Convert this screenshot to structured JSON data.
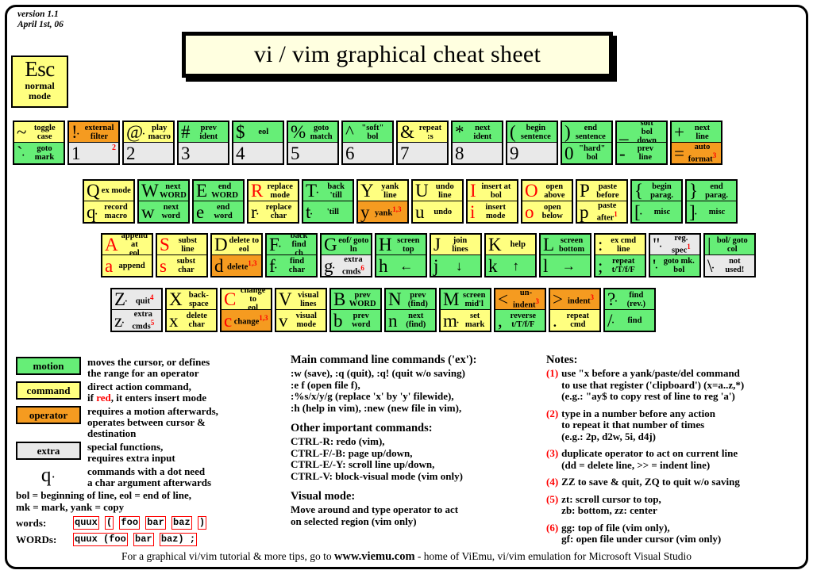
{
  "meta": {
    "version_line1": "version 1.1",
    "version_line2": "April 1st, 06",
    "title": "vi / vim graphical cheat sheet"
  },
  "esc_key": {
    "glyph": "Esc",
    "label_line1": "normal",
    "label_line2": "mode"
  },
  "colors": {
    "motion": "#66ee77",
    "command": "#ffff80",
    "operator": "#f59b20",
    "extra": "#e9e9e9",
    "insert_red": "#ff0000",
    "title_bg": "#ffffe0"
  },
  "keyboard": {
    "number_row": [
      {
        "top": {
          "glyph": "~",
          "label": "toggle case",
          "color": "command"
        },
        "bottom": {
          "glyph": "`",
          "dot": true,
          "label": "goto mark",
          "color": "motion"
        }
      },
      {
        "top": {
          "glyph": "!",
          "dot": true,
          "label": "external filter",
          "color": "operator"
        },
        "bottom": {
          "glyph": "1",
          "label": "",
          "color": "extra",
          "corner_sup": "2"
        }
      },
      {
        "top": {
          "glyph": "@",
          "dot": true,
          "label": "play macro",
          "color": "command"
        },
        "bottom": {
          "glyph": "2",
          "label": "",
          "color": "extra"
        }
      },
      {
        "top": {
          "glyph": "#",
          "label": "prev ident",
          "color": "motion"
        },
        "bottom": {
          "glyph": "3",
          "label": "",
          "color": "extra"
        }
      },
      {
        "top": {
          "glyph": "$",
          "label": "eol",
          "color": "motion"
        },
        "bottom": {
          "glyph": "4",
          "label": "",
          "color": "extra"
        }
      },
      {
        "top": {
          "glyph": "%",
          "label": "goto match",
          "color": "motion"
        },
        "bottom": {
          "glyph": "5",
          "label": "",
          "color": "extra"
        }
      },
      {
        "top": {
          "glyph": "^",
          "label": "\"soft\" bol",
          "color": "motion"
        },
        "bottom": {
          "glyph": "6",
          "label": "",
          "color": "extra"
        }
      },
      {
        "top": {
          "glyph": "&",
          "label": "repeat :s",
          "color": "command"
        },
        "bottom": {
          "glyph": "7",
          "label": "",
          "color": "extra"
        }
      },
      {
        "top": {
          "glyph": "*",
          "label": "next ident",
          "color": "motion"
        },
        "bottom": {
          "glyph": "8",
          "label": "",
          "color": "extra"
        }
      },
      {
        "top": {
          "glyph": "(",
          "label": "begin sentence",
          "color": "motion"
        },
        "bottom": {
          "glyph": "9",
          "label": "",
          "color": "extra"
        }
      },
      {
        "top": {
          "glyph": ")",
          "label": "end sentence",
          "color": "motion"
        },
        "bottom": {
          "glyph": "0",
          "label": "\"hard\" bol",
          "color": "motion"
        }
      },
      {
        "top": {
          "glyph": "_",
          "label": "\"soft\" bol down",
          "color": "motion",
          "glyph_under": true
        },
        "bottom": {
          "glyph": "-",
          "label": "prev line",
          "color": "motion"
        }
      },
      {
        "top": {
          "glyph": "+",
          "label": "next line",
          "color": "motion"
        },
        "bottom": {
          "glyph": "=",
          "label": "auto format",
          "color": "operator",
          "sup": "3"
        }
      }
    ],
    "q_row": [
      {
        "top": {
          "glyph": "Q",
          "label": "ex mode",
          "color": "command"
        },
        "bottom": {
          "glyph": "q",
          "dot": true,
          "label": "record macro",
          "color": "command"
        }
      },
      {
        "top": {
          "glyph": "W",
          "label": "next WORD",
          "color": "motion"
        },
        "bottom": {
          "glyph": "w",
          "label": "next word",
          "color": "motion"
        }
      },
      {
        "top": {
          "glyph": "E",
          "label": "end WORD",
          "color": "motion"
        },
        "bottom": {
          "glyph": "e",
          "label": "end word",
          "color": "motion"
        }
      },
      {
        "top": {
          "glyph": "R",
          "label": "replace mode",
          "color": "command",
          "red": true
        },
        "bottom": {
          "glyph": "r",
          "dot": true,
          "label": "replace char",
          "color": "command"
        }
      },
      {
        "top": {
          "glyph": "T",
          "dot": true,
          "label": "back 'till",
          "color": "motion"
        },
        "bottom": {
          "glyph": "t",
          "dot": true,
          "label": "'till",
          "color": "motion"
        }
      },
      {
        "top": {
          "glyph": "Y",
          "label": "yank line",
          "color": "command"
        },
        "bottom": {
          "glyph": "y",
          "label": "yank",
          "color": "operator",
          "sup": "1,3"
        }
      },
      {
        "top": {
          "glyph": "U",
          "label": "undo line",
          "color": "command"
        },
        "bottom": {
          "glyph": "u",
          "label": "undo",
          "color": "command"
        }
      },
      {
        "top": {
          "glyph": "I",
          "label": "insert at bol",
          "color": "command",
          "red": true
        },
        "bottom": {
          "glyph": "i",
          "label": "insert mode",
          "color": "command",
          "red": true
        }
      },
      {
        "top": {
          "glyph": "O",
          "label": "open above",
          "color": "command",
          "red": true
        },
        "bottom": {
          "glyph": "o",
          "label": "open below",
          "color": "command",
          "red": true
        }
      },
      {
        "top": {
          "glyph": "P",
          "label": "paste before",
          "color": "command"
        },
        "bottom": {
          "glyph": "p",
          "label": "paste after",
          "color": "command",
          "sup": "1"
        }
      },
      {
        "top": {
          "glyph": "{",
          "label": "begin parag.",
          "color": "motion"
        },
        "bottom": {
          "glyph": "[",
          "dot": true,
          "label": "misc",
          "color": "motion"
        }
      },
      {
        "top": {
          "glyph": "}",
          "label": "end parag.",
          "color": "motion"
        },
        "bottom": {
          "glyph": "]",
          "dot": true,
          "label": "misc",
          "color": "motion"
        }
      }
    ],
    "a_row": [
      {
        "top": {
          "glyph": "A",
          "label": "append at eol",
          "color": "command",
          "red": true
        },
        "bottom": {
          "glyph": "a",
          "label": "append",
          "color": "command",
          "red": true
        }
      },
      {
        "top": {
          "glyph": "S",
          "label": "subst line",
          "color": "command",
          "red": true
        },
        "bottom": {
          "glyph": "s",
          "label": "subst char",
          "color": "command",
          "red": true
        }
      },
      {
        "top": {
          "glyph": "D",
          "label": "delete to eol",
          "color": "command"
        },
        "bottom": {
          "glyph": "d",
          "label": "delete",
          "color": "operator",
          "sup": "1,3"
        }
      },
      {
        "top": {
          "glyph": "F",
          "dot": true,
          "label": "\"back\" find ch",
          "color": "motion"
        },
        "bottom": {
          "glyph": "f",
          "dot": true,
          "label": "find char",
          "color": "motion"
        }
      },
      {
        "top": {
          "glyph": "G",
          "label": "eof/ goto ln",
          "color": "motion"
        },
        "bottom": {
          "glyph": "g",
          "dot": true,
          "label": "extra cmds",
          "color": "extra",
          "sup": "6"
        }
      },
      {
        "top": {
          "glyph": "H",
          "label": "screen top",
          "color": "motion"
        },
        "bottom": {
          "glyph": "h",
          "label": "←",
          "color": "motion",
          "arrow": true
        }
      },
      {
        "top": {
          "glyph": "J",
          "label": "join lines",
          "color": "command"
        },
        "bottom": {
          "glyph": "j",
          "label": "↓",
          "color": "motion",
          "arrow": true
        }
      },
      {
        "top": {
          "glyph": "K",
          "label": "help",
          "color": "command"
        },
        "bottom": {
          "glyph": "k",
          "label": "↑",
          "color": "motion",
          "arrow": true
        }
      },
      {
        "top": {
          "glyph": "L",
          "label": "screen bottom",
          "color": "motion"
        },
        "bottom": {
          "glyph": "l",
          "label": "→",
          "color": "motion",
          "arrow": true
        }
      },
      {
        "top": {
          "glyph": ":",
          "label": "ex cmd line",
          "color": "command"
        },
        "bottom": {
          "glyph": ";",
          "label": "repeat t/T/f/F",
          "color": "motion"
        }
      },
      {
        "top": {
          "glyph": "\"",
          "dot": true,
          "label": "reg. spec",
          "color": "extra",
          "sup": "1"
        },
        "bottom": {
          "glyph": "'",
          "dot": true,
          "label": "goto mk. bol",
          "color": "motion"
        }
      },
      {
        "top": {
          "glyph": "|",
          "label": "bol/ goto col",
          "color": "motion"
        },
        "bottom": {
          "glyph": "\\",
          "dot": true,
          "label": "not used!",
          "color": "extra"
        }
      }
    ],
    "z_row": [
      {
        "top": {
          "glyph": "Z",
          "dot": true,
          "label": "quit",
          "color": "extra",
          "sup": "4"
        },
        "bottom": {
          "glyph": "z",
          "dot": true,
          "label": "extra cmds",
          "color": "extra",
          "sup": "5"
        }
      },
      {
        "top": {
          "glyph": "X",
          "label": "back- space",
          "color": "command"
        },
        "bottom": {
          "glyph": "x",
          "label": "delete char",
          "color": "command"
        }
      },
      {
        "top": {
          "glyph": "C",
          "label": "change to eol",
          "color": "command",
          "red": true
        },
        "bottom": {
          "glyph": "c",
          "label": "change",
          "color": "operator",
          "red": true,
          "sup": "1,3"
        }
      },
      {
        "top": {
          "glyph": "V",
          "label": "visual lines",
          "color": "command"
        },
        "bottom": {
          "glyph": "v",
          "label": "visual mode",
          "color": "command"
        }
      },
      {
        "top": {
          "glyph": "B",
          "label": "prev WORD",
          "color": "motion"
        },
        "bottom": {
          "glyph": "b",
          "label": "prev word",
          "color": "motion"
        }
      },
      {
        "top": {
          "glyph": "N",
          "label": "prev (find)",
          "color": "motion"
        },
        "bottom": {
          "glyph": "n",
          "label": "next (find)",
          "color": "motion"
        }
      },
      {
        "top": {
          "glyph": "M",
          "label": "screen mid'l",
          "color": "motion"
        },
        "bottom": {
          "glyph": "m",
          "dot": true,
          "label": "set mark",
          "color": "command"
        }
      },
      {
        "top": {
          "glyph": "<",
          "label": "un- indent",
          "color": "operator",
          "sup": "3"
        },
        "bottom": {
          "glyph": ",",
          "label": "reverse t/T/f/F",
          "color": "motion"
        }
      },
      {
        "top": {
          "glyph": ">",
          "label": "indent",
          "color": "operator",
          "sup": "3"
        },
        "bottom": {
          "glyph": ".",
          "label": "repeat cmd",
          "color": "command"
        }
      },
      {
        "top": {
          "glyph": "?",
          "dot": true,
          "label": "find (rev.)",
          "color": "motion"
        },
        "bottom": {
          "glyph": "/",
          "dot": true,
          "label": "find",
          "color": "motion"
        }
      }
    ]
  },
  "legend": [
    {
      "chip": "motion",
      "color": "motion",
      "line1": "moves the cursor, or defines",
      "line2": "the range for an operator"
    },
    {
      "chip": "command",
      "color": "command",
      "line1": "direct action command,",
      "line2": "if red, it enters insert mode",
      "red_word": "red"
    },
    {
      "chip": "operator",
      "color": "operator",
      "line1": "requires a motion afterwards,",
      "line2": "operates between cursor  &",
      "line3": "destination"
    },
    {
      "chip": "extra",
      "color": "extra",
      "line1": "special functions,",
      "line2": "requires extra input"
    }
  ],
  "legend_qdot": {
    "glyph": "q",
    "line1": "commands with a dot need",
    "line2": "a char argument afterwards"
  },
  "definitions": {
    "line1": "bol = beginning of line, eol = end of line,",
    "line2": "mk = mark, yank = copy",
    "words_label": "words:",
    "words_tokens": [
      "quux",
      "(",
      "foo",
      ",",
      "bar",
      ",",
      "baz",
      ")",
      ";"
    ],
    "words_boxes": [
      "quux",
      "(",
      "foo",
      "bar",
      "baz",
      ")"
    ],
    "wordsbig_label": "WORDs:",
    "wordsbig_boxes": [
      "quux (foo",
      "bar",
      "baz) ;"
    ]
  },
  "ex_commands": {
    "heading": "Main command line commands ('ex'):",
    "lines": [
      ":w (save), :q (quit), :q! (quit w/o saving)",
      ":e f (open file f),",
      ":%s/x/y/g (replace 'x' by 'y' filewide),",
      ":h (help in vim), :new (new file in vim),"
    ]
  },
  "other_commands": {
    "heading": "Other important commands:",
    "lines": [
      "CTRL-R: redo (vim),",
      "CTRL-F/-B: page up/down,",
      "CTRL-E/-Y: scroll line up/down,",
      "CTRL-V: block-visual mode (vim only)"
    ]
  },
  "visual_mode": {
    "heading": "Visual mode:",
    "lines": [
      "Move around and type operator to act",
      "on selected region (vim only)"
    ]
  },
  "notes": {
    "heading": "Notes:",
    "items": [
      {
        "num": "(1)",
        "lines": [
          "use \"x before a yank/paste/del command",
          "to use that register ('clipboard') (x=a..z,*)",
          "(e.g.: \"ay$ to copy rest of line to reg 'a')"
        ]
      },
      {
        "num": "(2)",
        "lines": [
          "type in a number before any action",
          "to repeat it that number of times",
          "(e.g.: 2p, d2w, 5i, d4j)"
        ]
      },
      {
        "num": "(3)",
        "lines": [
          "duplicate operator to act on current line",
          "(dd = delete line, >> = indent line)"
        ]
      },
      {
        "num": "(4)",
        "lines": [
          "ZZ to save & quit, ZQ to quit w/o saving"
        ]
      },
      {
        "num": "(5)",
        "lines": [
          "zt: scroll cursor to top,",
          "zb: bottom, zz: center"
        ]
      },
      {
        "num": "(6)",
        "lines": [
          "gg: top of file (vim only),",
          "gf: open file under cursor (vim only)"
        ]
      }
    ]
  },
  "footer": {
    "before": "For a graphical vi/vim tutorial & more tips, go to",
    "site": "www.viemu.com",
    "after": "- home of ViEmu, vi/vim emulation for Microsoft Visual Studio"
  }
}
